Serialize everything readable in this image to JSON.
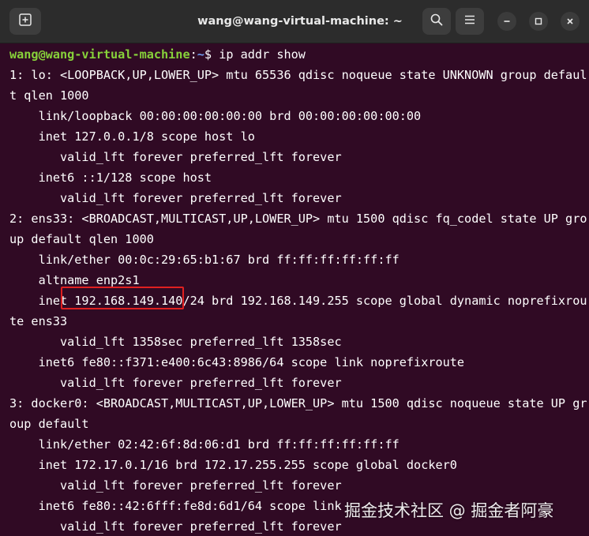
{
  "window": {
    "title": "wang@wang-virtual-machine: ~"
  },
  "icons": {
    "new_tab": "new-tab-icon",
    "search": "search-icon",
    "menu": "hamburger-menu-icon",
    "minimize": "minimize-icon",
    "maximize": "maximize-icon",
    "close": "close-icon"
  },
  "colors": {
    "terminal_bg": "#300a24",
    "prompt_user": "#87d23a",
    "prompt_path": "#6f9cf0",
    "highlight": "#e02020"
  },
  "prompt": {
    "user_host": "wang@wang-virtual-machine",
    "separator": ":",
    "path": "~",
    "symbol": "$ ",
    "command": "ip addr show"
  },
  "output": [
    "1: lo: <LOOPBACK,UP,LOWER_UP> mtu 65536 qdisc noqueue state UNKNOWN group defaul",
    "t qlen 1000",
    "    link/loopback 00:00:00:00:00:00 brd 00:00:00:00:00:00",
    "    inet 127.0.0.1/8 scope host lo",
    "       valid_lft forever preferred_lft forever",
    "    inet6 ::1/128 scope host",
    "       valid_lft forever preferred_lft forever",
    "2: ens33: <BROADCAST,MULTICAST,UP,LOWER_UP> mtu 1500 qdisc fq_codel state UP gro",
    "up default qlen 1000",
    "    link/ether 00:0c:29:65:b1:67 brd ff:ff:ff:ff:ff:ff",
    "    altname enp2s1",
    "    inet 192.168.149.140/24 brd 192.168.149.255 scope global dynamic noprefixrou",
    "te ens33",
    "       valid_lft 1358sec preferred_lft 1358sec",
    "    inet6 fe80::f371:e400:6c43:8986/64 scope link noprefixroute",
    "       valid_lft forever preferred_lft forever",
    "3: docker0: <BROADCAST,MULTICAST,UP,LOWER_UP> mtu 1500 qdisc noqueue state UP gr",
    "oup default",
    "    link/ether 02:42:6f:8d:06:d1 brd ff:ff:ff:ff:ff:ff",
    "    inet 172.17.0.1/16 brd 172.17.255.255 scope global docker0",
    "       valid_lft forever preferred_lft forever",
    "    inet6 fe80::42:6fff:fe8d:6d1/64 scope link",
    "       valid_lft forever preferred_lft forever"
  ],
  "watermark": "掘金技术社区 @ 掘金者阿豪"
}
